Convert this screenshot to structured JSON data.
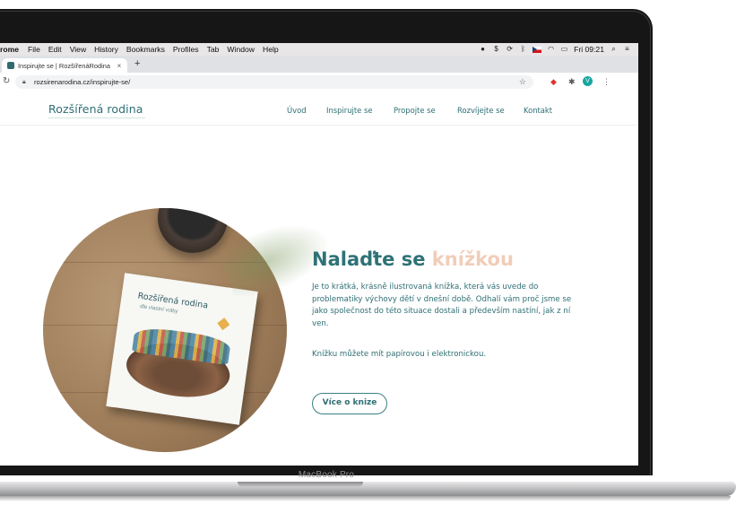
{
  "device": {
    "model_label": "MacBook Pro"
  },
  "menubar": {
    "items": [
      "rome",
      "File",
      "Edit",
      "View",
      "History",
      "Bookmarks",
      "Profiles",
      "Tab",
      "Window",
      "Help"
    ],
    "clock": "Fri 09:21"
  },
  "browser": {
    "tab_title": "Inspirujte se | RozšířenáRodina",
    "tab_close": "×",
    "new_tab": "+",
    "url": "rozsirenarodina.cz/inspirujte-se/",
    "profile_initial": "V"
  },
  "site": {
    "logo": "Rozšířená rodina",
    "nav": [
      "Úvod",
      "Inspirujte se",
      "Propojte se",
      "Rozvíjejte se",
      "Kontakt"
    ]
  },
  "hero": {
    "title_main": "Nalaďte se",
    "title_accent": "knížkou",
    "paragraph": "Je to krátká, krásně ilustrovaná knížka, která vás uvede do problematiky výchovy dětí v dnešní době. Odhalí vám proč jsme se jako společnost do této situace dostali a především nastíní, jak z ní ven.",
    "paragraph2": "Knížku můžete mít papírovou i elektronickou.",
    "cta_label": "Více o knize"
  },
  "book_cover": {
    "title": "Rozšířená rodina",
    "subtitle": "dle vlastní volby"
  },
  "colors": {
    "brand_teal": "#2e7276",
    "accent_peach": "#f1cdb8"
  }
}
